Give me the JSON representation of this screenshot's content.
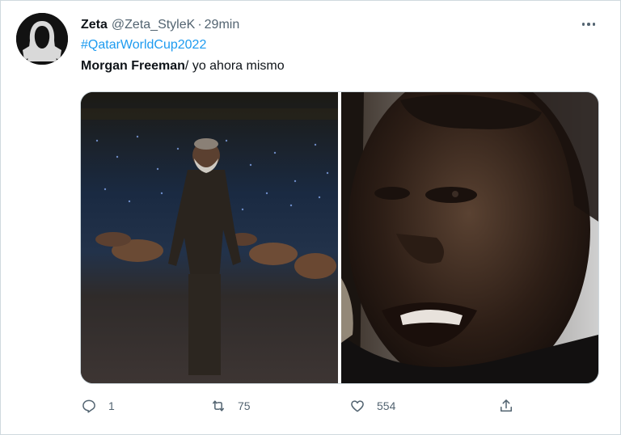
{
  "tweet": {
    "author_name": "Zeta",
    "author_handle": "@Zeta_StyleK",
    "separator": "·",
    "time": "29min",
    "hashtag": "#QatarWorldCup2022",
    "text_bold": "Morgan Freeman",
    "text_rest": "/ yo ahora mismo",
    "reply_count": "1",
    "retweet_count": "75",
    "like_count": "554"
  },
  "colors": {
    "link": "#1d9bf0",
    "secondary_text": "#536471",
    "border": "#cfd9de"
  },
  "icons": {
    "reply": "reply-icon",
    "retweet": "retweet-icon",
    "like": "heart-icon",
    "share": "share-icon",
    "more": "more-icon"
  }
}
